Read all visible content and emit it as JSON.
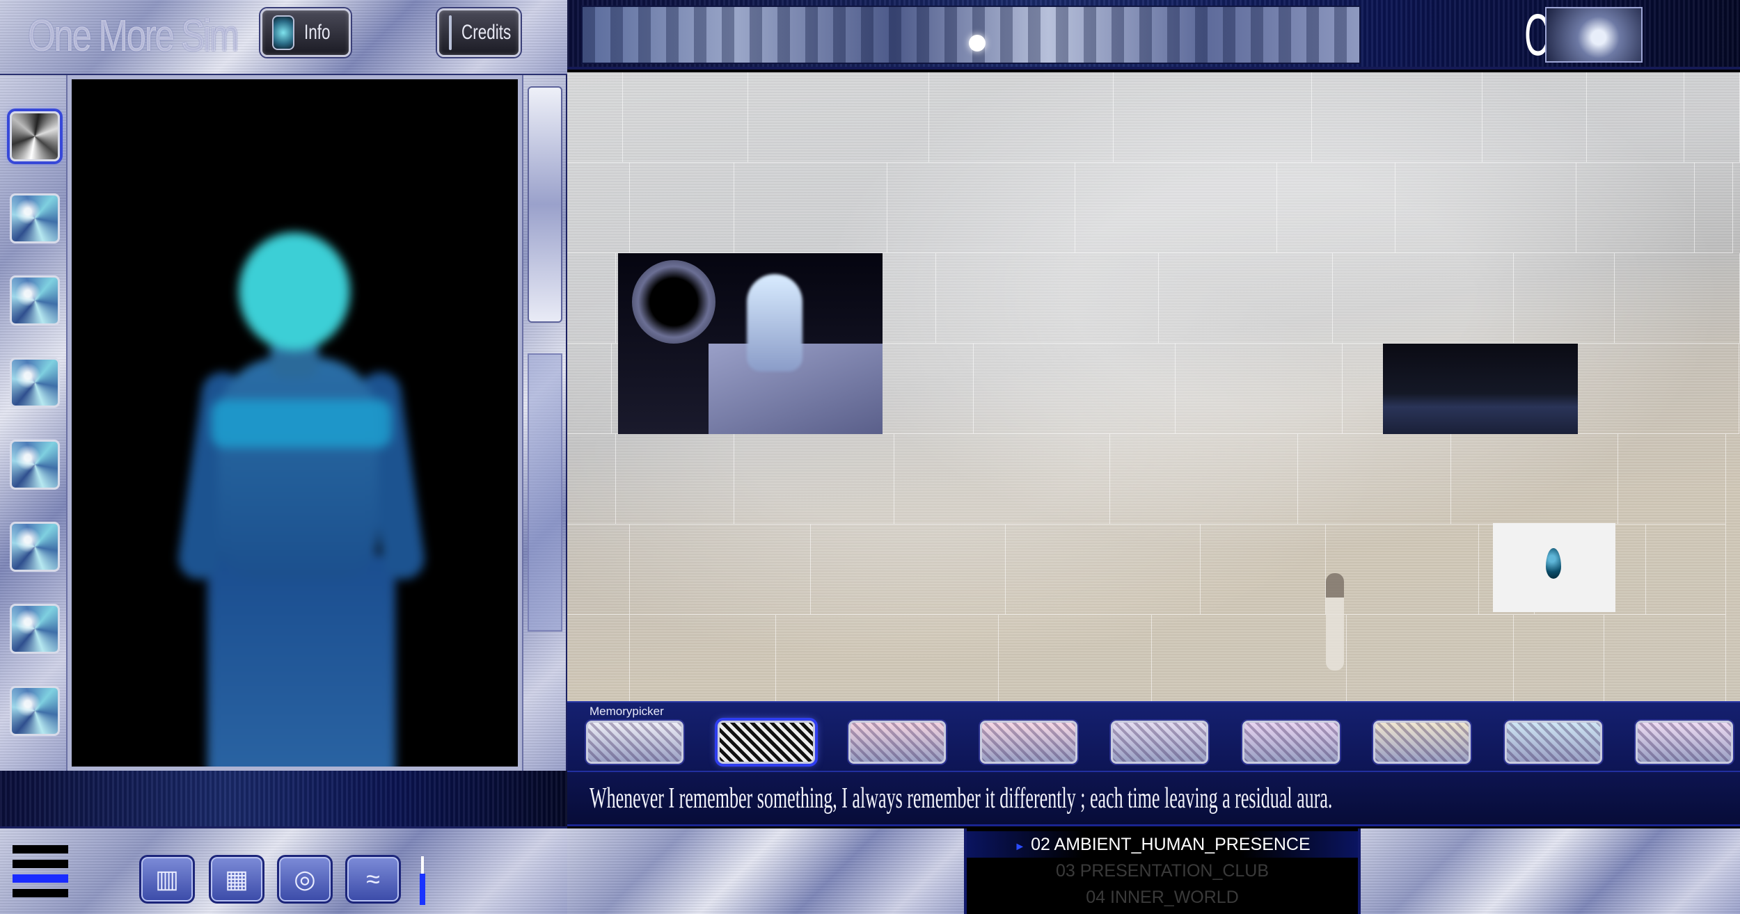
{
  "header": {
    "app_title": "One More Sim",
    "info_label": "Info",
    "credits_label": "Credits"
  },
  "banner": {
    "click_cells_label": "Click cells"
  },
  "memorypicker": {
    "label": "Memorypicker",
    "items": [
      "memory-1",
      "memory-2",
      "memory-3",
      "memory-4",
      "memory-5",
      "memory-6",
      "memory-7",
      "memory-8",
      "memory-9"
    ],
    "active_index": 1
  },
  "quote": "Whenever I remember something, I always remember it differently ; each time leaving a residual aura.",
  "playlist": {
    "tracks": [
      {
        "label": "02 AMBIENT_HUMAN_PRESENCE",
        "active": true
      },
      {
        "label": "03 PRESENTATION_CLUB",
        "active": false
      },
      {
        "label": "04 INNER_WORLD",
        "active": false
      }
    ]
  },
  "sidebar": {
    "thumbs": [
      "thumb-1",
      "thumb-2",
      "thumb-3",
      "thumb-4",
      "thumb-5",
      "thumb-6",
      "thumb-7",
      "thumb-8"
    ],
    "active_index": 0
  },
  "toolbar": {
    "buttons": [
      {
        "icon": "bars-icon",
        "glyph": "▥"
      },
      {
        "icon": "grid-icon",
        "glyph": "▦"
      },
      {
        "icon": "spiral-icon",
        "glyph": "◎"
      },
      {
        "icon": "wave-icon",
        "glyph": "≈"
      }
    ],
    "slider_level": 0.65
  },
  "colors": {
    "accent_blue": "#2f3ef0",
    "panel_navy": "#0d1555",
    "figure_cyan": "#3ccfd6"
  }
}
